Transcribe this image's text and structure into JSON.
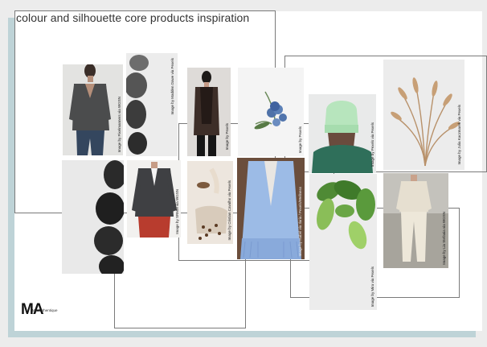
{
  "title": "colour and silhouette core products inspiration",
  "logo": {
    "mark": "MA",
    "subtext": "MA Authentique"
  },
  "credits": {
    "sweater": "Image by Pixelmanners via WGSN",
    "stones": "Image by Madden Dawe via Pexels",
    "scarf": "Image by Pexels",
    "blue_flower": "Image by Pexels",
    "beanie": "Image by Pexels via Pexels",
    "wheat": "Image by Julia Kaczmarek via Pexels",
    "cardigan": "Image by SRMM via WGSN",
    "coffee": "Image by Cristian Cavalho via Pexels",
    "blue_coat": "Image by Isabel via Ilaria / Pexels/Wellness",
    "leaves": "Image by Mira via Pexels",
    "cream_outfit": "Image by Lia Stefania via WGSN"
  },
  "colors": {
    "background": "#ececec",
    "accent_band": "#bed3d7",
    "board": "#ffffff",
    "frame_line": "#7a7a7a"
  }
}
